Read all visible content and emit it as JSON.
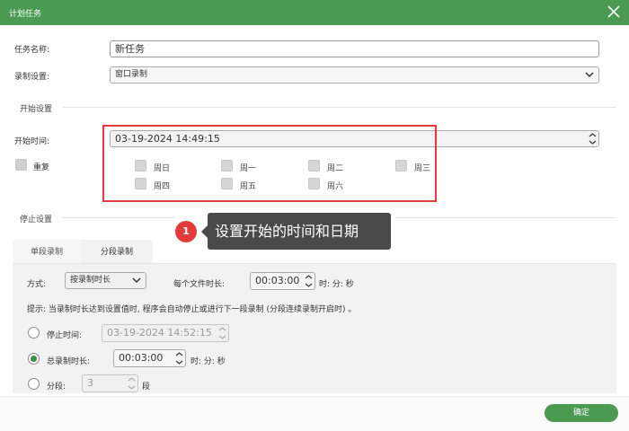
{
  "window": {
    "title": "计划任务",
    "close_icon": "close-icon"
  },
  "task_name": {
    "label": "任务名称:",
    "value": "新任务"
  },
  "record_setting": {
    "label": "录制设置:",
    "selected": "窗口录制"
  },
  "start_section": {
    "heading": "开始设置",
    "start_time_label": "开始时间:",
    "start_time_value": "03-19-2024 14:49:15",
    "repeat_label": "重复",
    "weekdays": [
      "周日",
      "周一",
      "周二",
      "周三",
      "周四",
      "周五",
      "周六"
    ]
  },
  "stop_section": {
    "heading": "停止设置"
  },
  "annotation": {
    "number": "1",
    "text": "设置开始的时间和日期"
  },
  "tabs": [
    "单段录制",
    "分段录制"
  ],
  "segment": {
    "mode_label": "方式:",
    "mode_value": "按录制时长",
    "per_file_label": "每个文件时长:",
    "per_file_value": "00:03:00",
    "per_file_unit": "时: 分: 秒",
    "hint": "提示: 当录制时长达到设置值时, 程序会自动停止或进行下一段录制 (分段连续录制开启时) 。",
    "stop_time_label": "停止时间:",
    "stop_time_value": "03-19-2024 14:52:15",
    "total_label": "总录制时长:",
    "total_value": "00:03:00",
    "total_unit": "时: 分: 秒",
    "segments_label": "分段:",
    "segments_value": "3",
    "segments_unit": "段"
  },
  "footer": {
    "ok_label": "确定"
  },
  "colors": {
    "accent": "#4a9a52",
    "highlight": "#e33b3b",
    "callout_bg": "#4a4a4a"
  }
}
